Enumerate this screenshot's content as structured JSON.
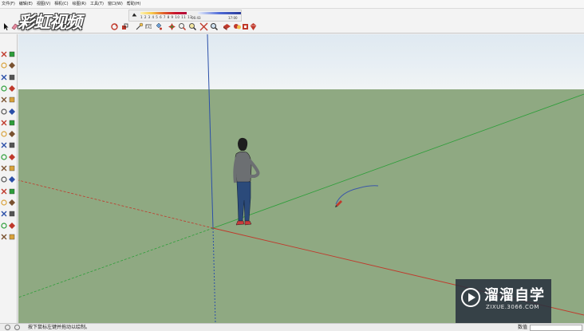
{
  "menubar": {
    "items": [
      "文件(F)",
      "编辑(E)",
      "视图(V)",
      "相机(C)",
      "绘图(R)",
      "工具(T)",
      "窗口(W)",
      "帮助(H)"
    ]
  },
  "logo": {
    "text": "彩虹视频"
  },
  "shadow_panel": {
    "ticks": "1 2 3 4 5 6 7 8 9 10 11 12",
    "time_start": "06:43",
    "time_end": "17:00"
  },
  "toolbar": {
    "icons": [
      "select-arrow-icon",
      "eraser-icon",
      "paint-bucket-icon",
      "move-icon",
      "rotate-icon",
      "scale-icon",
      "tape-measure-icon",
      "text-icon",
      "orbit-icon",
      "pan-icon",
      "zoom-icon",
      "zoom-extents-icon",
      "warehouse-icon",
      "extension-icon",
      "layout-icon",
      "ruby-icon"
    ]
  },
  "palette": {
    "icons": [
      "select-icon",
      "component-icon",
      "paint-icon",
      "eraser-icon",
      "line-icon",
      "freehand-icon",
      "rectangle-icon",
      "rotated-rect-icon",
      "circle-icon",
      "polygon-icon",
      "arc-icon",
      "pie-icon",
      "arc3-icon",
      "arc2-icon",
      "move-icon",
      "push-pull-icon",
      "rotate-icon",
      "follow-me-icon",
      "scale-icon",
      "offset-icon",
      "tape-icon",
      "dimension-icon",
      "protractor-icon",
      "text-icon",
      "axes-icon",
      "3d-text-icon",
      "orbit-icon",
      "pan-icon",
      "zoom-icon",
      "zoom-window-icon",
      "zoom-extents-icon",
      "position-camera-icon",
      "walk-icon",
      "look-around-icon"
    ]
  },
  "watermark": {
    "title": "溜溜自学",
    "url": "ZIXUE.3066.COM"
  },
  "statusbar": {
    "hint": "按下鼠标左键并拖动以绘制。",
    "measure_label": "数值",
    "measure_value": ""
  },
  "colors": {
    "ground": "#8fa982",
    "sky": "#e4ecf2",
    "axis_red": "#c0392b",
    "axis_green": "#2e9e3a",
    "axis_blue": "#2b4fa8",
    "freehand_stroke": "#3b57a8"
  }
}
